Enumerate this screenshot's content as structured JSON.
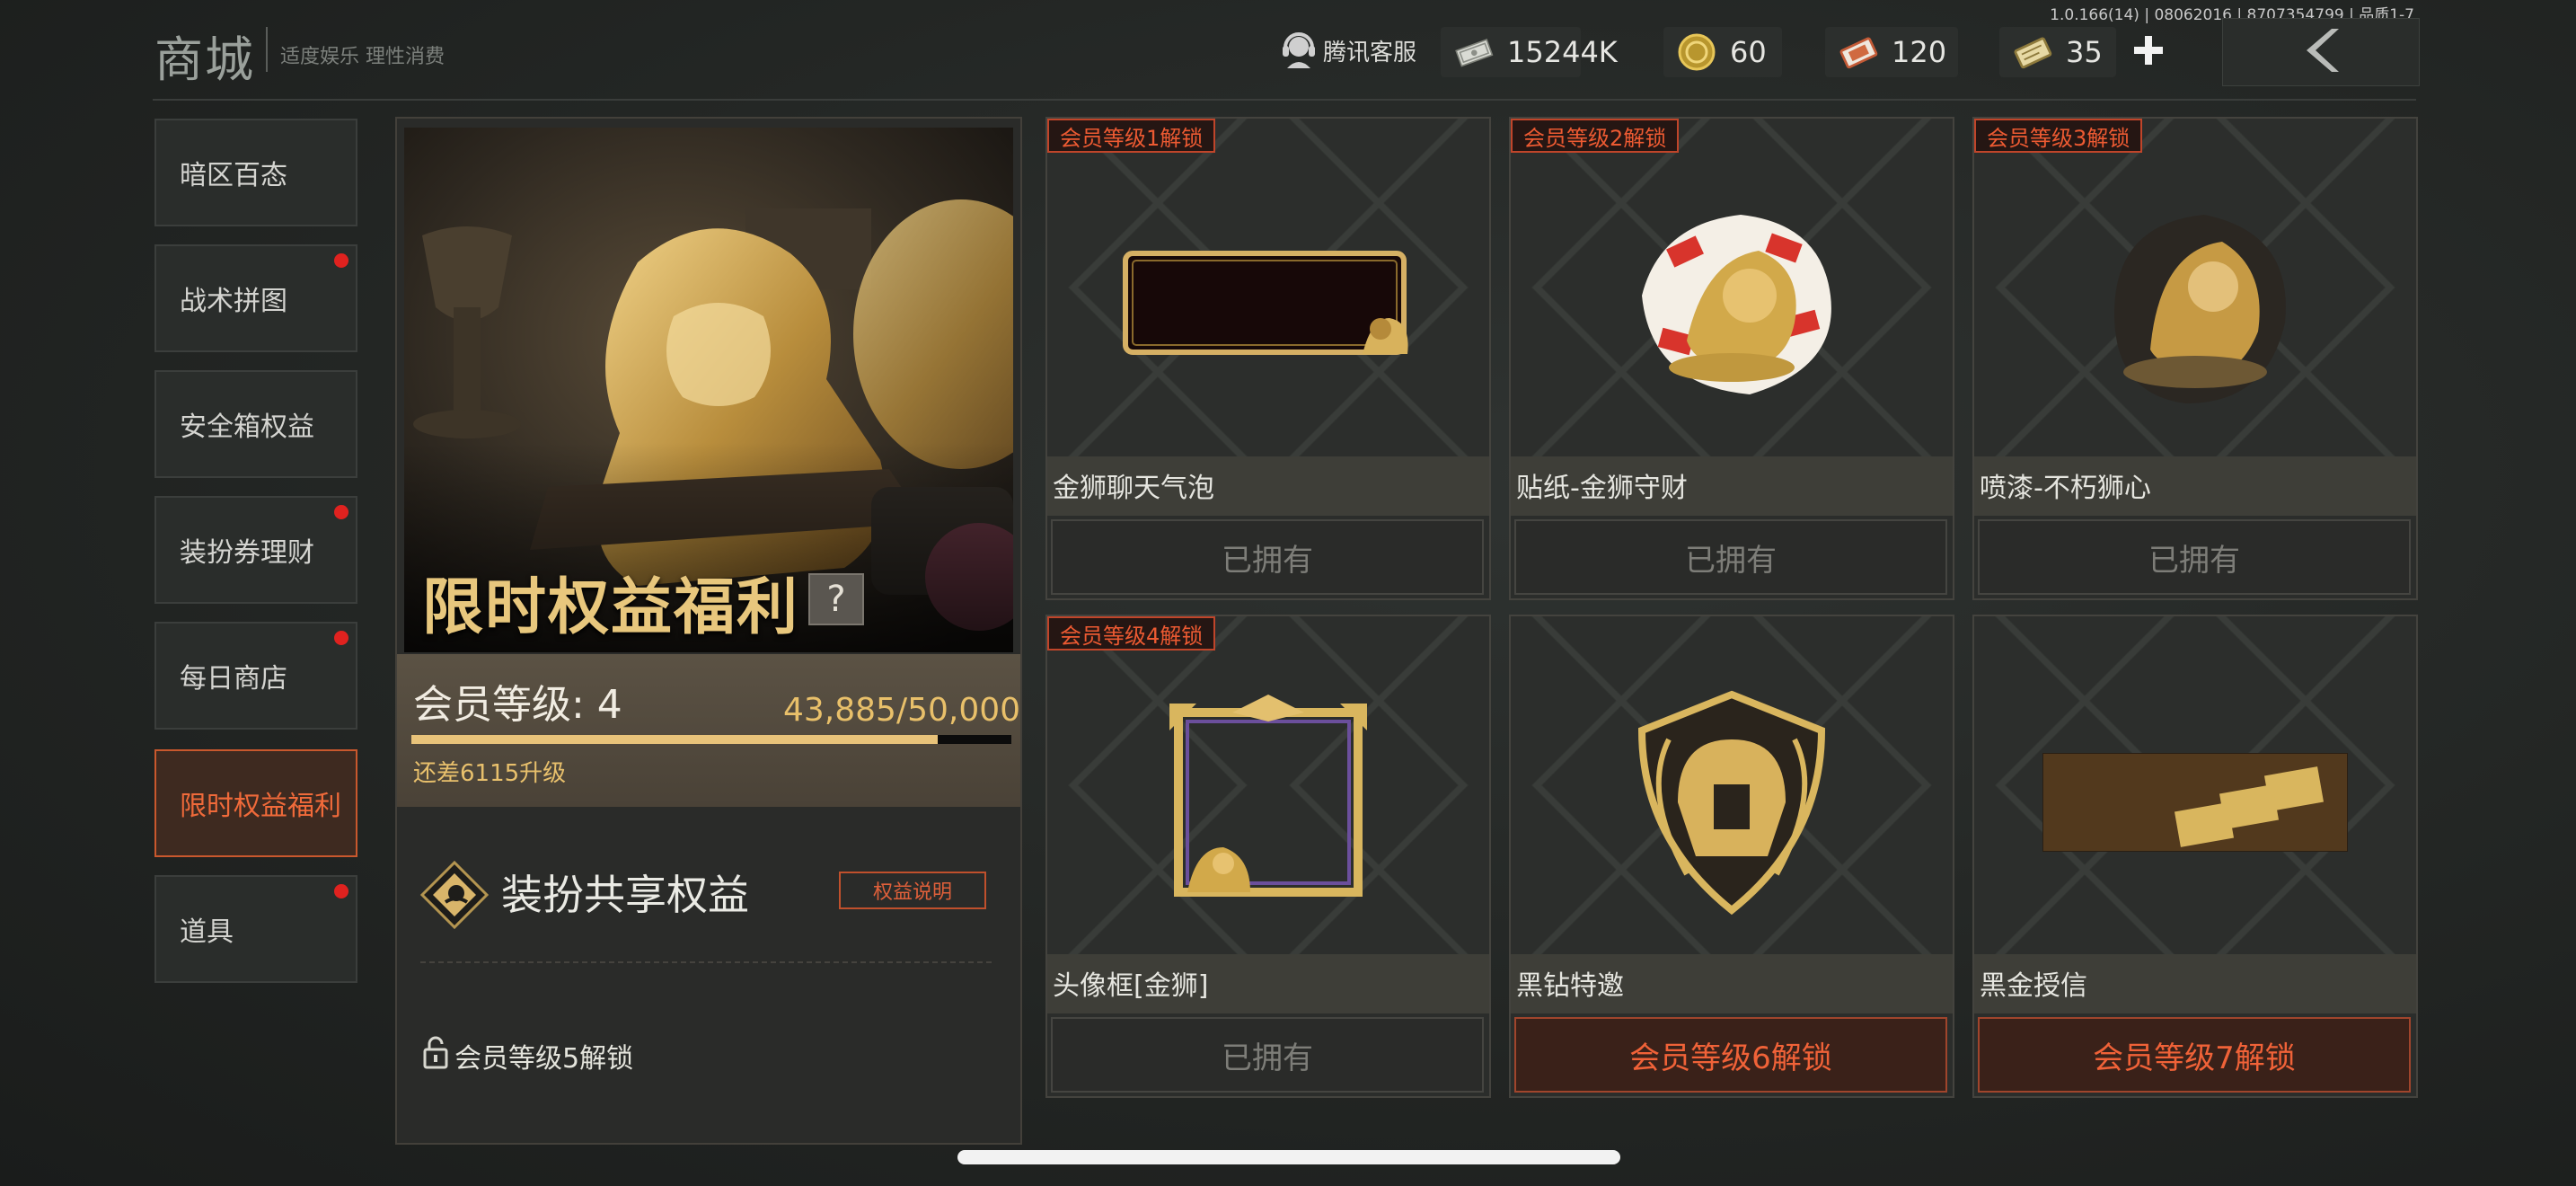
{
  "header": {
    "title": "商城",
    "slogan": "适度娱乐 理性消费",
    "version": "1.0.166(14) | 08062016 | 8707354799 | 品质1-7",
    "customer_service": "腾讯客服",
    "currencies": [
      {
        "icon": "banknote-icon",
        "value": "15244K"
      },
      {
        "icon": "gold-coin-icon",
        "value": "60"
      },
      {
        "icon": "coupon-ticket-icon",
        "value": "120"
      },
      {
        "icon": "gold-ticket-icon",
        "value": "35"
      }
    ]
  },
  "sidebar": {
    "items": [
      {
        "label": "暗区百态",
        "badge": false,
        "active": false
      },
      {
        "label": "战术拼图",
        "badge": true,
        "active": false
      },
      {
        "label": "安全箱权益",
        "badge": false,
        "active": false
      },
      {
        "label": "装扮券理财",
        "badge": true,
        "active": false
      },
      {
        "label": "每日商店",
        "badge": true,
        "active": false
      },
      {
        "label": "限时权益福利",
        "badge": false,
        "active": true
      },
      {
        "label": "道具",
        "badge": true,
        "active": false
      }
    ]
  },
  "panel": {
    "hero_title": "限时权益福利",
    "help": "?",
    "level_label": "会员等级: 4",
    "progress_text": "43,885/50,000",
    "progress_fraction": 0.8777,
    "remaining": "还差6115升级",
    "share_title": "装扮共享权益",
    "benefit_button": "权益说明",
    "unlock_note": "会员等级5解锁"
  },
  "cards": [
    {
      "tag": "会员等级1解锁",
      "name": "金狮聊天气泡",
      "status": "已拥有",
      "locked": false,
      "icon": "chat-bubble-icon"
    },
    {
      "tag": "会员等级2解锁",
      "name": "贴纸-金狮守财",
      "status": "已拥有",
      "locked": false,
      "icon": "lion-sticker-icon"
    },
    {
      "tag": "会员等级3解锁",
      "name": "喷漆-不朽狮心",
      "status": "已拥有",
      "locked": false,
      "icon": "lion-spray-icon"
    },
    {
      "tag": "会员等级4解锁",
      "name": "头像框[金狮]",
      "status": "已拥有",
      "locked": false,
      "icon": "avatar-frame-icon"
    },
    {
      "tag": "",
      "name": "黑钻特邀",
      "status": "会员等级6解锁",
      "locked": true,
      "icon": "helmet-emblem-icon"
    },
    {
      "tag": "",
      "name": "黑金授信",
      "status": "会员等级7解锁",
      "locked": true,
      "icon": "gold-card-icon"
    }
  ]
}
